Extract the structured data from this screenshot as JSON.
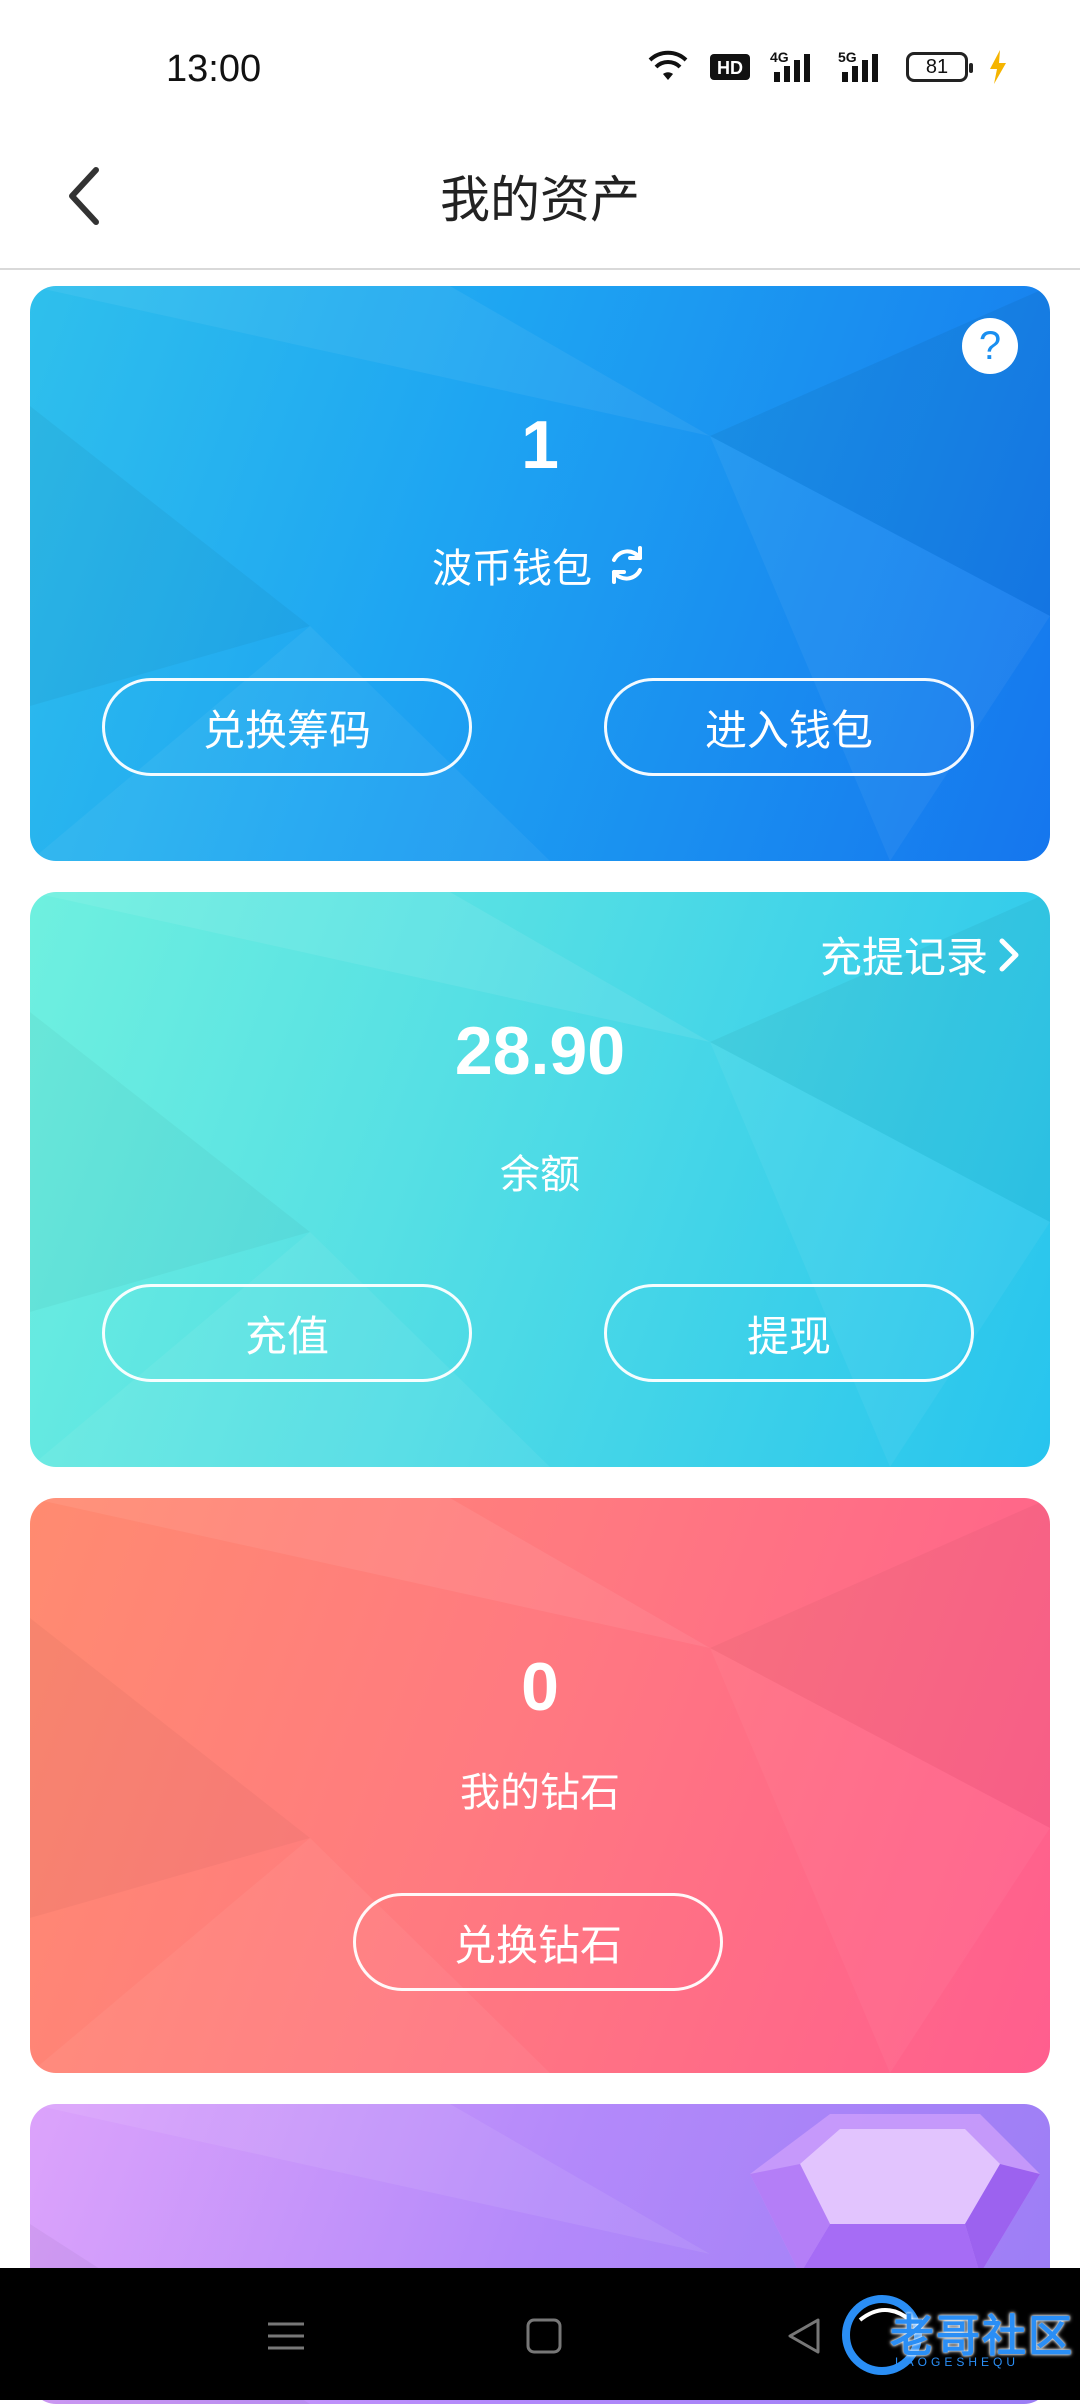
{
  "status": {
    "time": "13:00",
    "hd_label": "HD",
    "net1": "4G",
    "net2": "5G",
    "battery": "81"
  },
  "nav": {
    "title": "我的资产"
  },
  "wallet_card": {
    "value": "1",
    "label": "波币钱包",
    "btn_exchange": "兑换筹码",
    "btn_enter": "进入钱包"
  },
  "balance_card": {
    "records_link": "充提记录",
    "value": "28.90",
    "label": "余额",
    "btn_recharge": "充值",
    "btn_withdraw": "提现"
  },
  "diamond_card": {
    "value": "0",
    "label": "我的钻石",
    "btn_exchange": "兑换钻石"
  },
  "watermark": {
    "text": "老哥社区",
    "sub": "LAOGESHEQU"
  },
  "colors": {
    "wallet_card": "#1e9ff2",
    "balance_card": "#4fd9e6",
    "diamond_card": "#ff7382",
    "purple_card": "#b98bfa",
    "bottom_nav": "#000000"
  }
}
